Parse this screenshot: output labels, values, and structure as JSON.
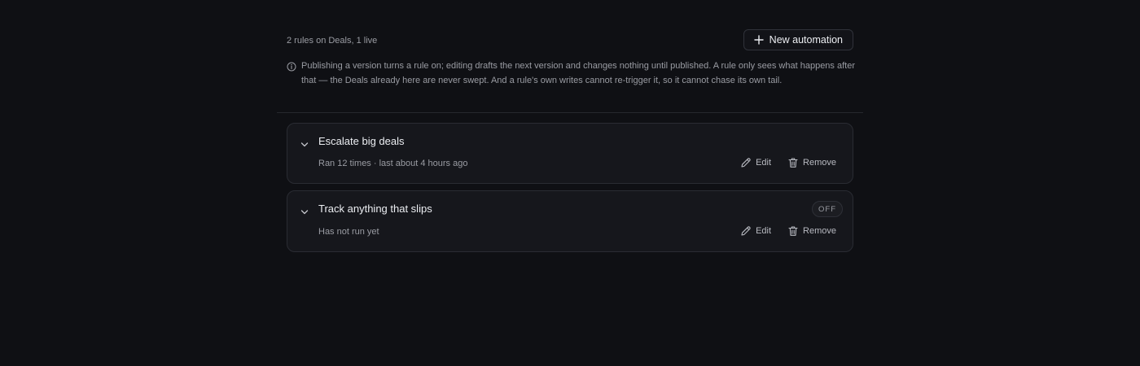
{
  "header": {
    "summary": "2 rules on Deals, 1 live",
    "new_button_label": "New automation",
    "new_button_icon": "plus-icon"
  },
  "info": {
    "icon": "info-icon",
    "text": "Publishing a version turns a rule on; editing drafts the next version and changes nothing until published. A rule only sees what happens after that — the Deals already here are never swept. And a rule's own writes cannot re-trigger it, so it cannot chase its own tail."
  },
  "rules": [
    {
      "title": "Escalate big deals",
      "meta": "Ran 12 times · last about 4 hours ago",
      "status": null,
      "edit_label": "Edit",
      "remove_label": "Remove"
    },
    {
      "title": "Track anything that slips",
      "meta": "Has not run yet",
      "status": "OFF",
      "edit_label": "Edit",
      "remove_label": "Remove"
    }
  ],
  "colors": {
    "background": "#0f1014",
    "card": "#16171c",
    "border": "#2a2c33",
    "text_primary": "#eceef2",
    "text_muted": "#9a9ca3"
  }
}
